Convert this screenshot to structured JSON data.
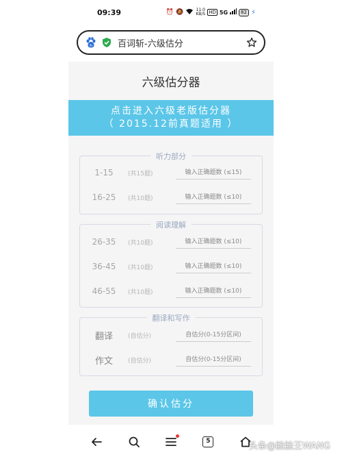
{
  "status_bar": {
    "time": "09:39",
    "network_speed_top": "11.0",
    "network_speed_unit": "KB/S",
    "hd_label": "HD",
    "signal_label": "5G",
    "battery": "82"
  },
  "browser": {
    "title": "百词斩-六级估分",
    "icons": [
      "baidu-paw-icon",
      "shield-check-icon",
      "star-icon"
    ]
  },
  "page": {
    "title": "六级估分器",
    "banner_line1": "点击进入六级老版估分器",
    "banner_line2": "（ 2015.12前真题适用 ）",
    "sections": [
      {
        "legend": "听力部分",
        "rows": [
          {
            "range": "1-15",
            "count": "(共15题)",
            "placeholder": "输入正确题数 (≤15)"
          },
          {
            "range": "16-25",
            "count": "(共10题)",
            "placeholder": "输入正确题数 (≤10)"
          }
        ]
      },
      {
        "legend": "阅读理解",
        "rows": [
          {
            "range": "26-35",
            "count": "(共10题)",
            "placeholder": "输入正确题数 (≤10)"
          },
          {
            "range": "36-45",
            "count": "(共10题)",
            "placeholder": "输入正确题数 (≤10)"
          },
          {
            "range": "46-55",
            "count": "(共10题)",
            "placeholder": "输入正确题数 (≤10)"
          }
        ]
      },
      {
        "legend": "翻译和写作",
        "rows": [
          {
            "range": "翻译",
            "count": "(自估分)",
            "placeholder": "自估分(0-15分区间)"
          },
          {
            "range": "作文",
            "count": "(自估分)",
            "placeholder": "自估分(0-15分区间)"
          }
        ]
      }
    ],
    "confirm_label": "确认估分"
  },
  "nav": {
    "tab_count": "5",
    "icons": [
      "back-arrow-icon",
      "search-icon",
      "menu-icon",
      "tabs-icon",
      "home-icon"
    ]
  },
  "watermark": "头条@脸脸王WANG"
}
